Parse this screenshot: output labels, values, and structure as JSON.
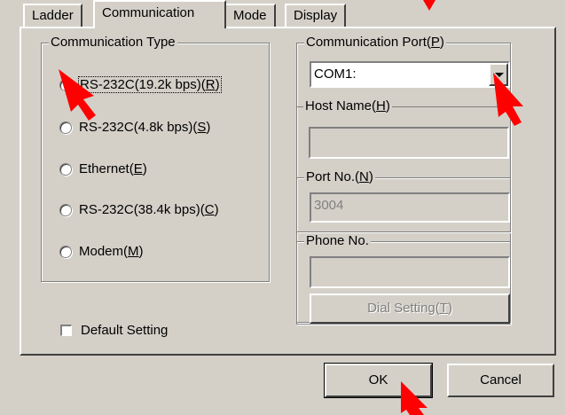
{
  "tabs": [
    {
      "label": "Ladder",
      "active": false
    },
    {
      "label": "Communication",
      "active": true
    },
    {
      "label": "Mode",
      "active": false
    },
    {
      "label": "Display",
      "active": false
    }
  ],
  "communication_type": {
    "title": "Communication Type",
    "options": [
      {
        "text": "RS-232C(19.2k bps)(",
        "key": "R",
        "checked": true
      },
      {
        "text": "RS-232C(4.8k bps)(",
        "key": "S",
        "checked": false
      },
      {
        "text": "Ethernet(",
        "key": "E",
        "checked": false
      },
      {
        "text": "RS-232C(38.4k bps)(",
        "key": "C",
        "checked": false
      },
      {
        "text": "Modem(",
        "key": "M",
        "checked": false
      }
    ]
  },
  "default_setting": {
    "label": "Default Setting",
    "checked": false
  },
  "communication_port": {
    "title_text": "Communication Port(",
    "title_key": "P",
    "selected": "COM1:"
  },
  "host_name": {
    "title_text": "Host Name(",
    "title_key": "H",
    "value": ""
  },
  "port_no": {
    "title_text": "Port No.(",
    "title_key": "N",
    "value": "3004"
  },
  "phone_no": {
    "title": "Phone No.",
    "value": ""
  },
  "dial_setting": {
    "label_text": "Dial Setting(",
    "label_key": "T"
  },
  "ok_label": "OK",
  "cancel_label": "Cancel",
  "colors": {
    "pointer": "#ff0000",
    "face": "#d4d0c8"
  }
}
